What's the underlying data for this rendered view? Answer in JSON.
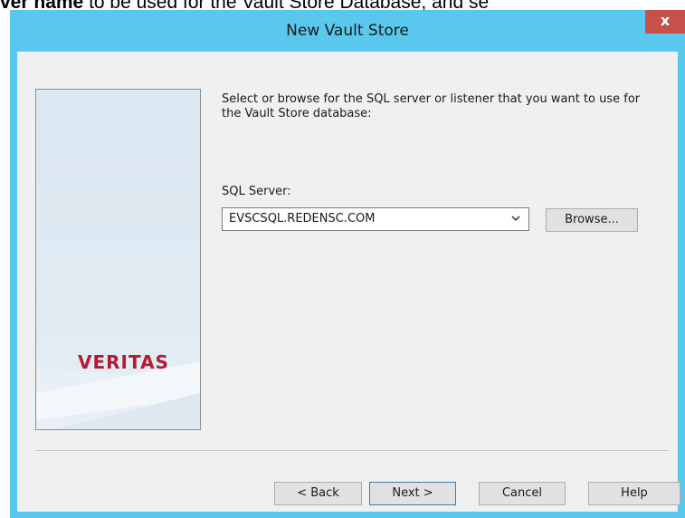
{
  "background": {
    "caption_bold": "ver name",
    "caption_rest": " to be used for the Vault Store Database, and se"
  },
  "window": {
    "title": "New Vault Store",
    "close_label": "x"
  },
  "side_panel": {
    "logo_text": "VERITAS"
  },
  "main": {
    "instructions": "Select or browse for the SQL server or listener that you want to use for the Vault Store database:",
    "sql_server_label": "SQL Server:",
    "sql_server_value": "EVSCSQL.REDENSC.COM",
    "browse_label": "Browse..."
  },
  "footer": {
    "back_label": "< Back",
    "next_label": "Next >",
    "cancel_label": "Cancel",
    "help_label": "Help"
  },
  "colors": {
    "titlebar": "#5ac7ec",
    "close_button": "#c7514a",
    "logo": "#b31b34"
  }
}
